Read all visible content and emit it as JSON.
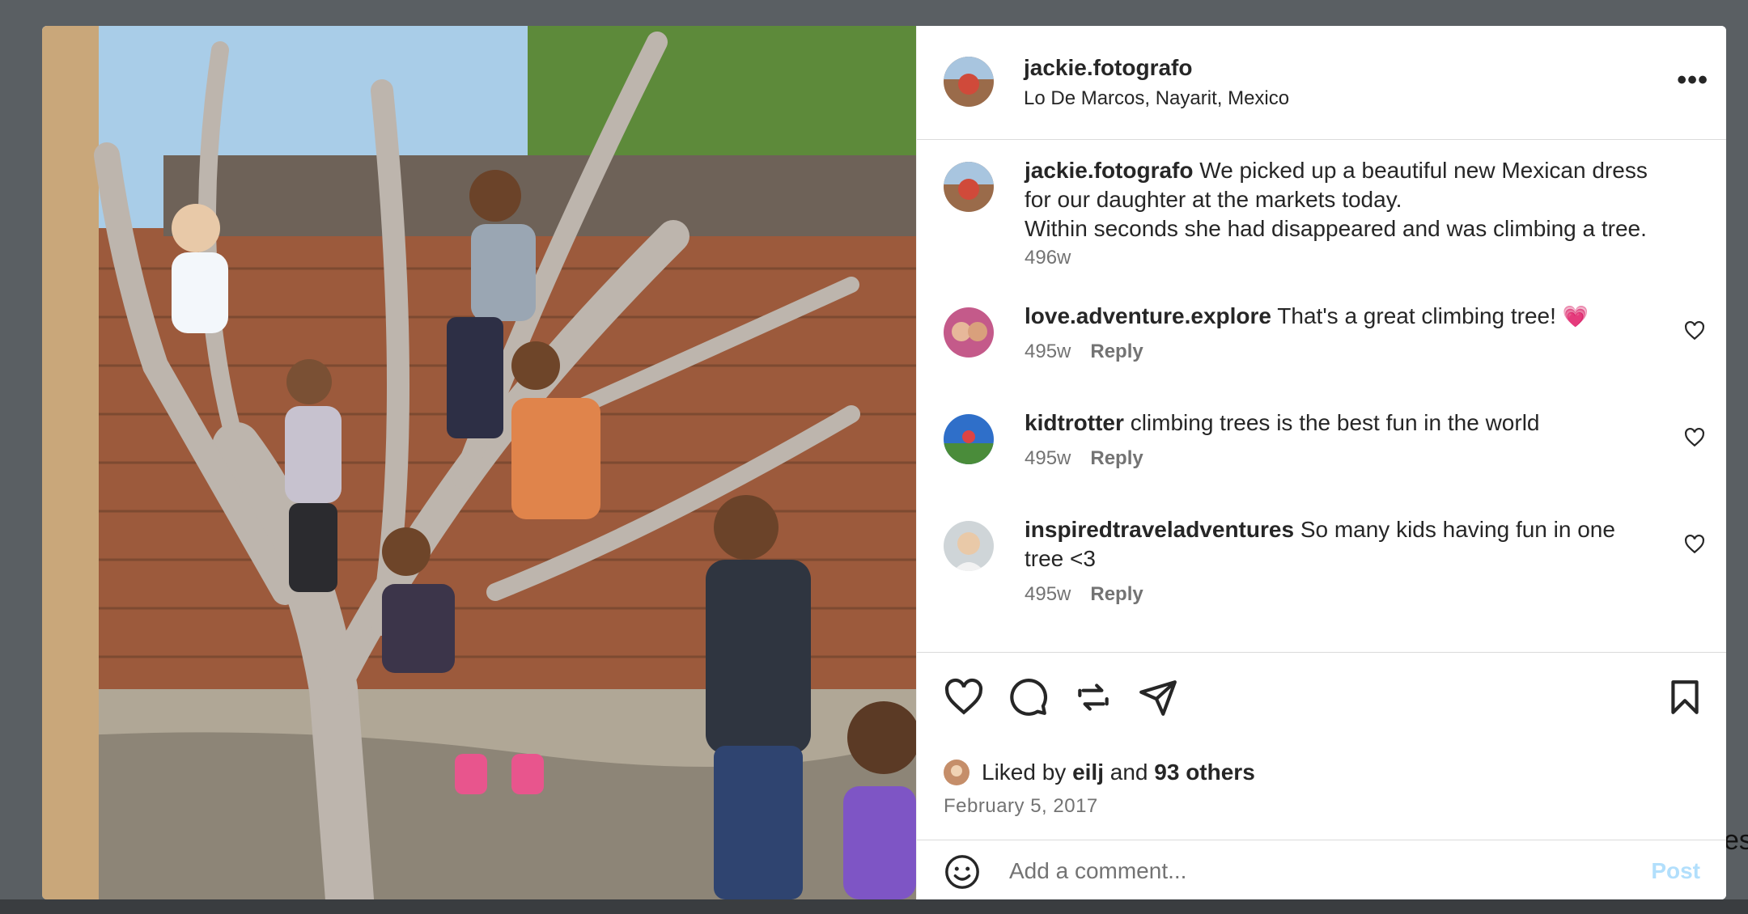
{
  "post": {
    "username": "jackie.fotografo",
    "location": "Lo De Marcos, Nayarit, Mexico",
    "more_icon": "more-horizontal-icon",
    "caption": {
      "username": "jackie.fotografo",
      "line1": "We picked up a beautiful new Mexican dress",
      "line2": "for our daughter at the markets today.",
      "line3": "Within seconds she had disappeared and was climbing a tree.",
      "time": "496w"
    },
    "comments": [
      {
        "username": "love.adventure.explore",
        "text": "That's a great climbing tree!",
        "emoji": "💗",
        "time": "495w",
        "reply": "Reply"
      },
      {
        "username": "kidtrotter",
        "text": "climbing trees is the best fun in the world",
        "time": "495w",
        "reply": "Reply"
      },
      {
        "username": "inspiredtraveladventures",
        "text": "So many kids having fun in one",
        "text2": "tree <3",
        "time": "495w",
        "reply": "Reply"
      }
    ],
    "likes": {
      "prefix": "Liked by",
      "user": "eilj",
      "middle": "and",
      "others": "93 others"
    },
    "date": "February 5, 2017",
    "comment_box": {
      "placeholder": "Add a comment...",
      "post_label": "Post"
    }
  },
  "background_text": "es",
  "colors": {
    "link": "#0095f6",
    "post_disabled": "#b2dffc",
    "heart_pink": "#ff3fa4"
  }
}
